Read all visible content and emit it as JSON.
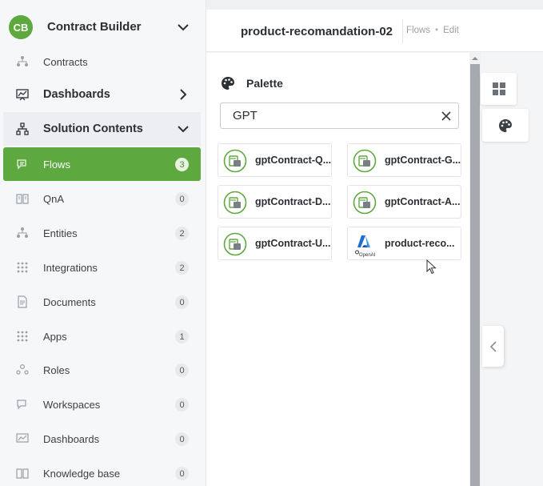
{
  "sidebar": {
    "avatar_initials": "CB",
    "title": "Contract Builder",
    "items": [
      {
        "label": "Contracts",
        "badge": null
      },
      {
        "label": "Dashboards",
        "badge": null
      },
      {
        "label": "Solution Contents",
        "badge": null
      },
      {
        "label": "Flows",
        "badge": "3"
      },
      {
        "label": "QnA",
        "badge": "0"
      },
      {
        "label": "Entities",
        "badge": "2"
      },
      {
        "label": "Integrations",
        "badge": "2"
      },
      {
        "label": "Documents",
        "badge": "0"
      },
      {
        "label": "Apps",
        "badge": "1"
      },
      {
        "label": "Roles",
        "badge": "0"
      },
      {
        "label": "Workspaces",
        "badge": "0"
      },
      {
        "label": "Dashboards",
        "badge": "0"
      },
      {
        "label": "Knowledge base",
        "badge": "0"
      }
    ]
  },
  "header": {
    "title": "product-recomandation-02",
    "breadcrumb": [
      "Flows",
      "Edit"
    ],
    "separator": "•"
  },
  "palette": {
    "title": "Palette",
    "search_value": "GPT",
    "cards": [
      {
        "label": "gptContract-Q...",
        "icon": "flow-icon"
      },
      {
        "label": "gptContract-G...",
        "icon": "flow-icon"
      },
      {
        "label": "gptContract-D...",
        "icon": "flow-icon"
      },
      {
        "label": "gptContract-A...",
        "icon": "flow-icon"
      },
      {
        "label": "gptContract-U...",
        "icon": "flow-icon"
      },
      {
        "label": "product-reco...",
        "icon": "azure-openai-icon",
        "icon_caption": "OpenAI"
      }
    ]
  },
  "colors": {
    "accent": "#5da83f",
    "badge_bg": "#e7e9ec",
    "text": "#2b2f33"
  }
}
